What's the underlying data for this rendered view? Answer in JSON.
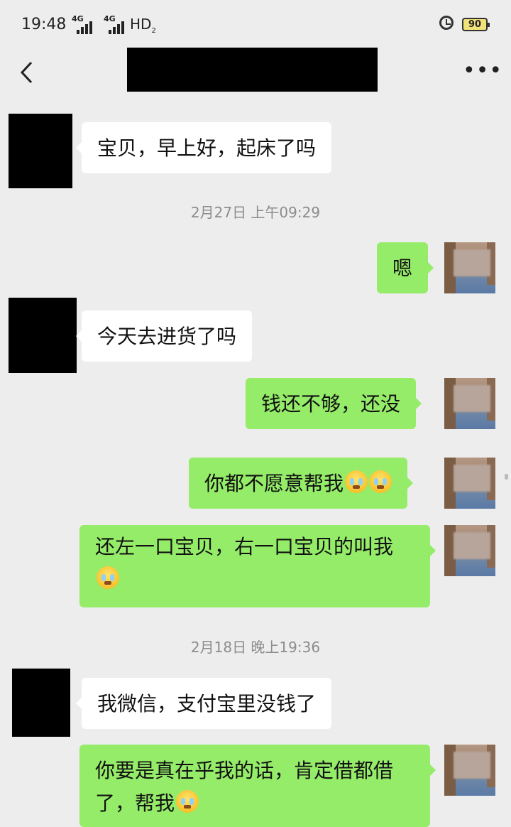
{
  "status_bar": {
    "time": "19:48",
    "network1": "4G",
    "network2": "4G",
    "hd": "HD",
    "hd_sub": "2",
    "battery": "90"
  },
  "nav": {
    "title": "",
    "back_icon": "chevron-left-icon",
    "more_icon": "more-dots-icon",
    "more_label": "•••"
  },
  "messages": [
    {
      "side": "left",
      "text": "宝贝，早上好，起床了吗"
    },
    {
      "type": "timestamp",
      "text": "2月27日 上午09:29"
    },
    {
      "side": "right",
      "text": "嗯"
    },
    {
      "side": "left",
      "text": "今天去进货了吗"
    },
    {
      "side": "right",
      "text": "钱还不够，还没"
    },
    {
      "side": "right",
      "text": "你都不愿意帮我",
      "emojis": 2
    },
    {
      "side": "right",
      "text": "还左一口宝贝，右一口宝贝的叫我",
      "emojis": 1
    },
    {
      "type": "timestamp",
      "text": "2月18日 晚上19:36"
    },
    {
      "side": "left",
      "text": "我微信，支付宝里没钱了"
    },
    {
      "side": "right",
      "text": "你要是真在乎我的话，肯定借都借了，帮我",
      "emojis": 1
    }
  ],
  "colors": {
    "background": "#ededed",
    "bubble_right": "#95ec69",
    "bubble_left": "#ffffff",
    "timestamp": "#8c8c8c"
  }
}
